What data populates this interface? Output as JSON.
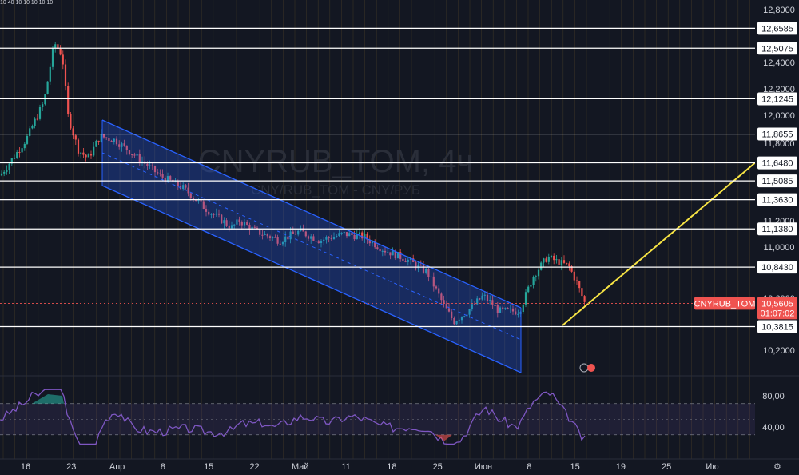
{
  "chart_data": {
    "type": "candlestick",
    "symbol_watermark": "CNYRUB_TOM, 4ч",
    "symbol_sub_watermark": "CNY/RUB_TOM - CNY/РУБ",
    "x_tick_labels": [
      "16",
      "23",
      "Апр",
      "8",
      "15",
      "22",
      "Май",
      "11",
      "18",
      "25",
      "Июн",
      "8",
      "15",
      "19",
      "25",
      "Ию"
    ],
    "price_axis_ticks": [
      "12,8000",
      "12,4000",
      "12,2000",
      "12,0000",
      "11,8000",
      "11,2000",
      "11,0000",
      "10,6000",
      "10,2000"
    ],
    "price_range": [
      10.0,
      12.85
    ],
    "horizontal_levels": [
      12.6585,
      12.5075,
      12.1245,
      11.8655,
      11.648,
      11.5085,
      11.363,
      11.138,
      10.843,
      10.3815
    ],
    "horizontal_level_labels": [
      "12,6585",
      "12,5075",
      "12,1245",
      "11,8655",
      "11,6480",
      "11,5085",
      "11,3630",
      "11,1380",
      "10,8430",
      "10,3815"
    ],
    "current_price": {
      "symbol": "CNYRUB_TOM",
      "value": 10.5605,
      "label": "10,5605",
      "countdown": "01:07:02"
    },
    "rsi": {
      "range": [
        0,
        100
      ],
      "tick_labels": [
        "80,00",
        "40,00"
      ],
      "band": [
        30,
        70
      ]
    },
    "top_badges": "10 40 10 10 10 10 10",
    "colors": {
      "background": "#131722",
      "up": "#26a69a",
      "down": "#ef5350",
      "channel": "#2962ff",
      "trendline": "#f7e444",
      "rsi": "#7e57c2",
      "level": "#ffffff"
    }
  }
}
